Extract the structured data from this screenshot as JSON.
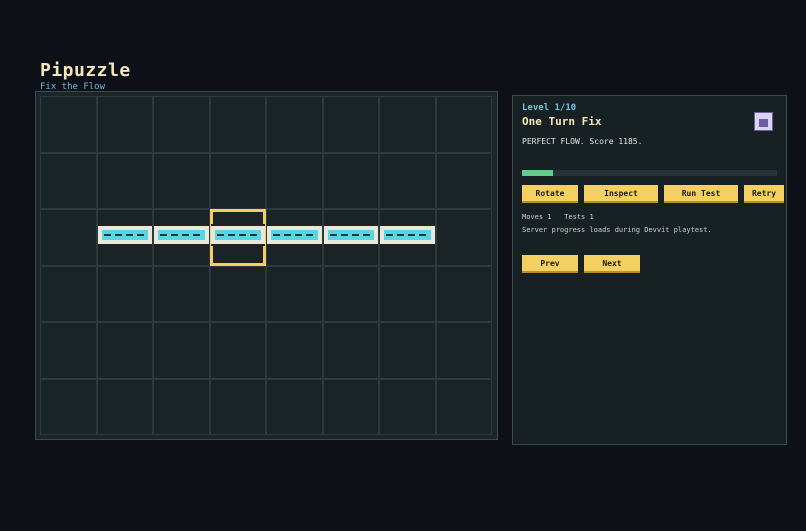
{
  "header": {
    "title": "Pipuzzle",
    "subtitle": "Fix the Flow"
  },
  "board": {
    "cols": 8,
    "rows": 6,
    "pipe_row": 3,
    "pipe_cols": [
      2,
      3,
      4,
      5,
      6,
      7
    ],
    "selected": {
      "row": 3,
      "col": 4
    }
  },
  "panel": {
    "level": "Level 1/10",
    "level_name": "One Turn Fix",
    "status": "PERFECT FLOW. Score 1185.",
    "progress": 0.12,
    "actions": {
      "rotate": "Rotate",
      "inspect": "Inspect",
      "run_test": "Run Test",
      "retry": "Retry"
    },
    "moves_label": "Moves 1",
    "tests_label": "Tests 1",
    "note": "Server progress loads during Devvit playtest.",
    "nav": {
      "prev": "Prev",
      "next": "Next"
    },
    "avatar_icon": "robot-avatar-icon"
  },
  "colors": {
    "accent": "#f4cf62",
    "water": "#56d6e3",
    "progress": "#5fd08a"
  }
}
